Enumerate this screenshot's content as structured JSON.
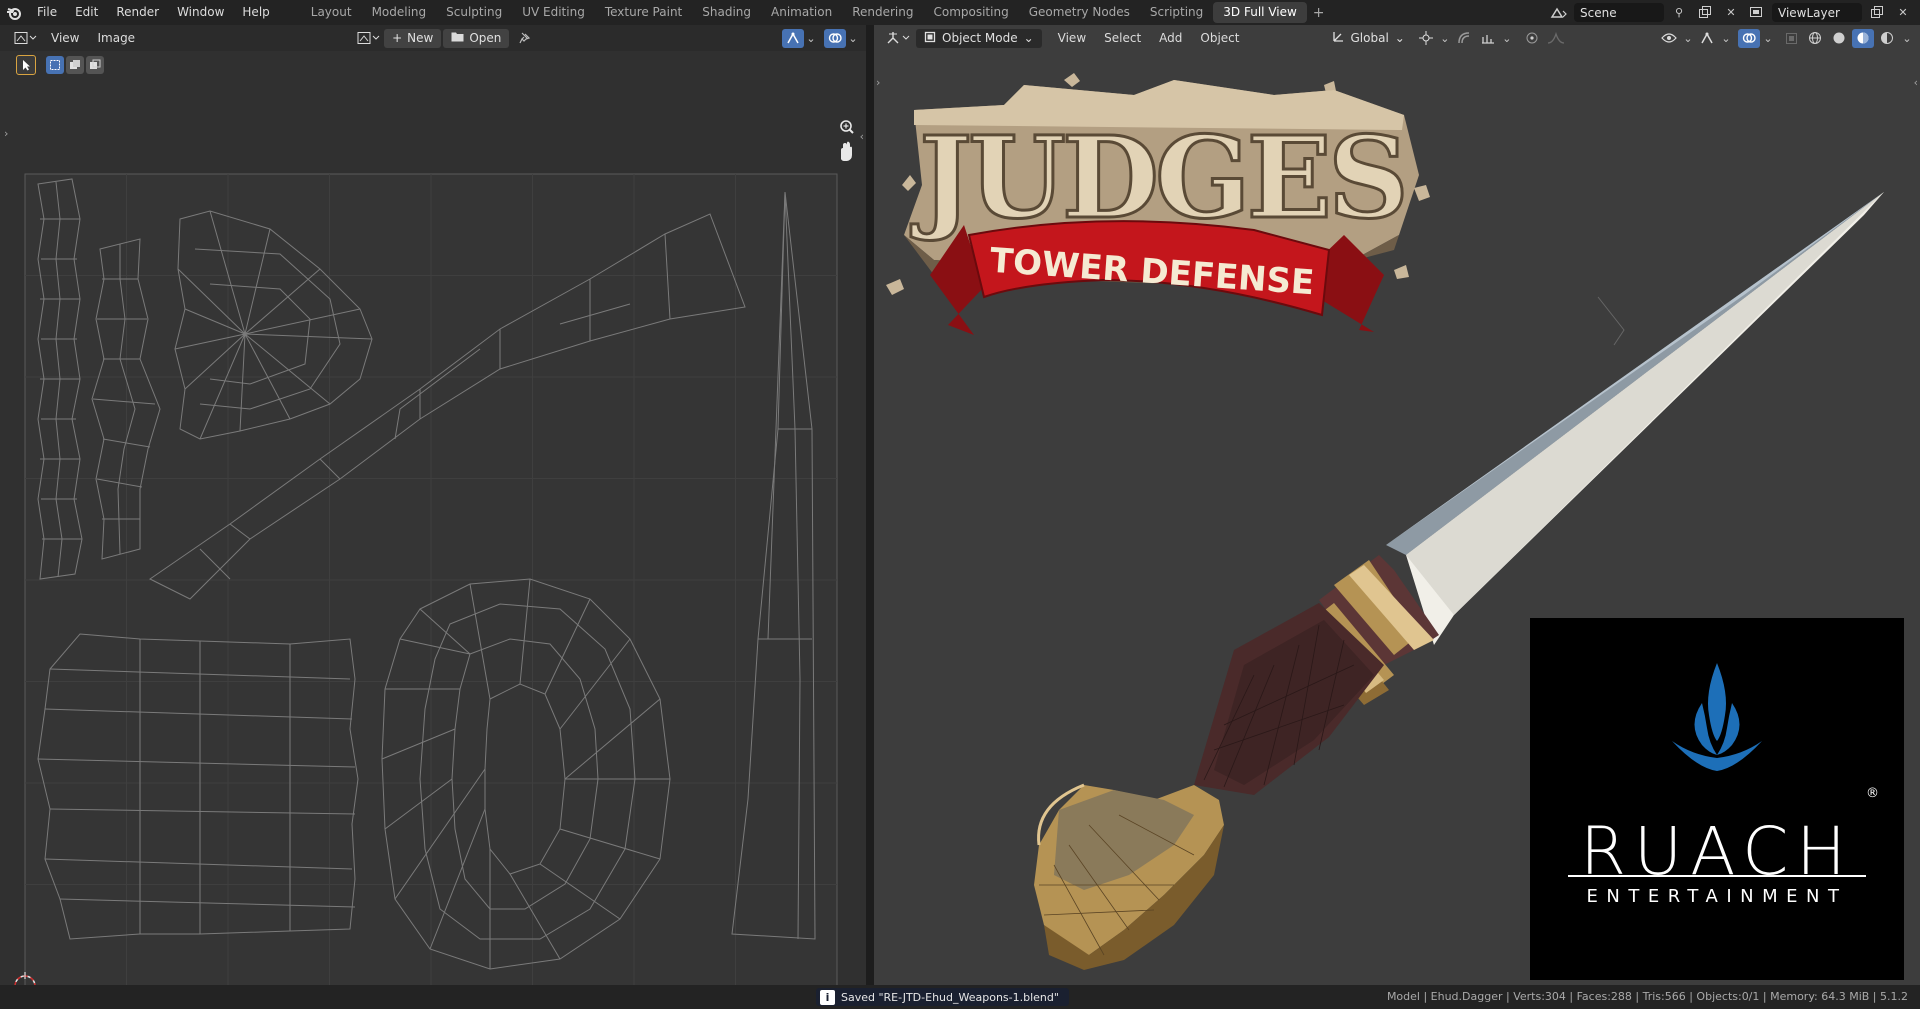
{
  "menubar": {
    "menus": [
      "File",
      "Edit",
      "Render",
      "Window",
      "Help"
    ],
    "workspaces": [
      "Layout",
      "Modeling",
      "Sculpting",
      "UV Editing",
      "Texture Paint",
      "Shading",
      "Animation",
      "Rendering",
      "Compositing",
      "Geometry Nodes",
      "Scripting",
      "3D Full View"
    ],
    "active_workspace": "3D Full View",
    "add_workspace": "+",
    "scene_name": "Scene",
    "view_layer_name": "ViewLayer"
  },
  "uv_editor": {
    "menus": [
      "View",
      "Image"
    ],
    "new_label": "New",
    "open_label": "Open"
  },
  "viewport": {
    "mode_label": "Object Mode",
    "menus": [
      "View",
      "Select",
      "Add",
      "Object"
    ],
    "transform_orientation": "Global",
    "logo_judges": "JUDGES",
    "logo_banner": "TOWER DEFENSE",
    "ruach_word": "RUACH",
    "ruach_reg": "®",
    "ruach_sub": "ENTERTAINMENT"
  },
  "statusbar": {
    "message": "Saved \"RE-JTD-Ehud_Weapons-1.blend\"",
    "info_icon": "i",
    "stats": "Model | Ehud.Dagger | Verts:304 | Faces:288 | Tris:566 | Objects:0/1 | Memory: 64.3 MiB | 5.1.2"
  },
  "colors": {
    "accent_blue": "#4772b3",
    "flame_blue": "#1d6fb8",
    "banner_red": "#c4161c",
    "handle_brown": "#4a2a2a",
    "gold": "#b8995a"
  }
}
